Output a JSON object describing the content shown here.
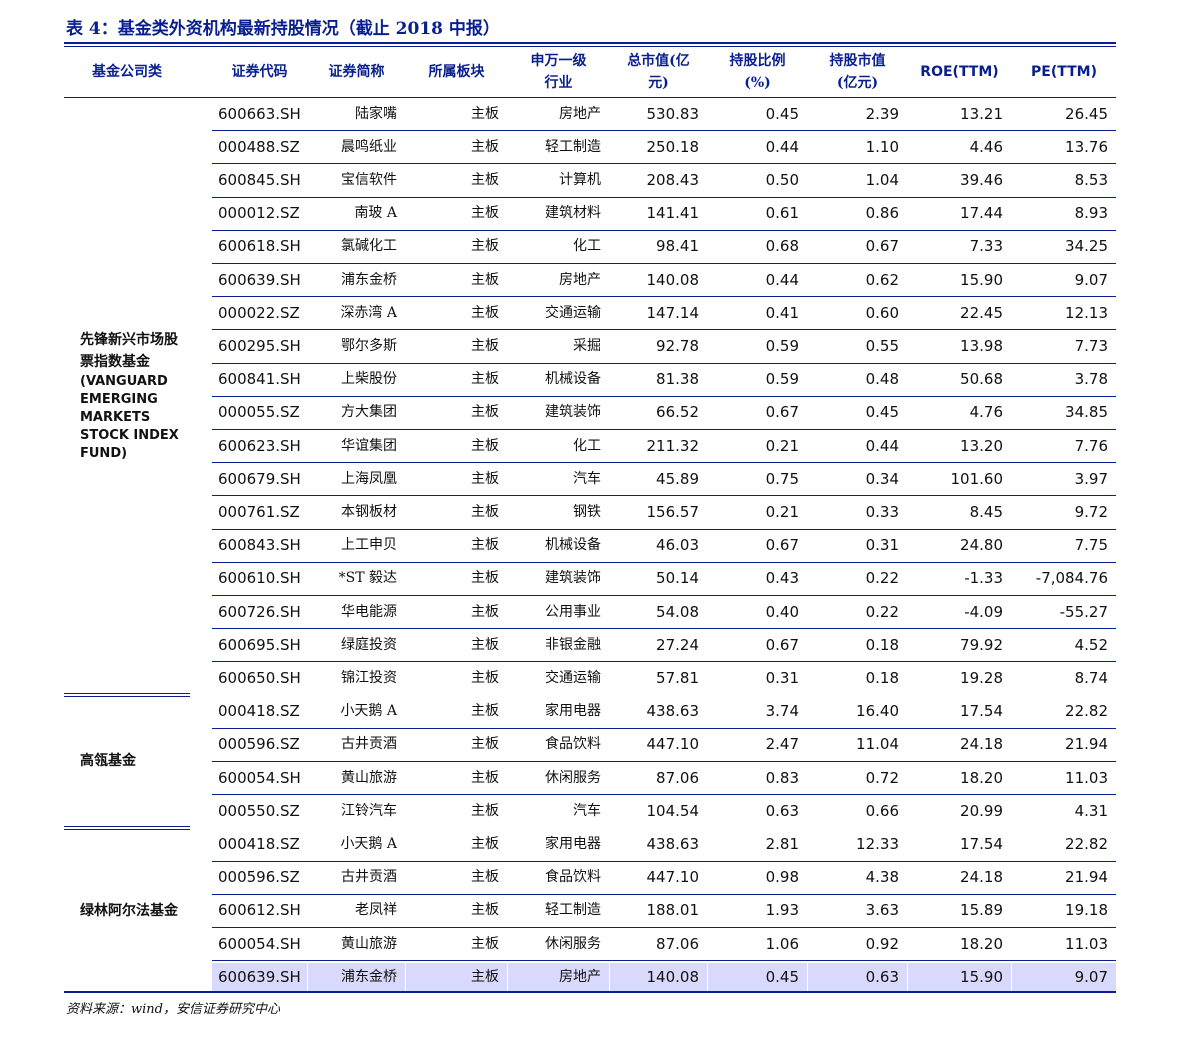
{
  "title": "表 4：基金类外资机构最新持股情况（截止 2018 中报）",
  "headers": {
    "fund": "基金公司类",
    "code": "证券代码",
    "name": "证券简称",
    "board": "所属板块",
    "industry_l1": "申万一级",
    "industry_l2": "行业",
    "mktcap_l1": "总市值(亿",
    "mktcap_l2": "元)",
    "ratio_l1": "持股比例",
    "ratio_l2": "(%)",
    "value_l1": "持股市值",
    "value_l2": "(亿元)",
    "roe": "ROE(TTM)",
    "pe": "PE(TTM)"
  },
  "groups": [
    {
      "label_cn": "先锋新兴市场股票指数基金",
      "label_en": "(VANGUARD EMERGING MARKETS STOCK INDEX FUND)",
      "rows": [
        {
          "code": "600663.SH",
          "name": "陆家嘴",
          "board": "主板",
          "industry": "房地产",
          "mktcap": "530.83",
          "ratio": "0.45",
          "value": "2.39",
          "roe": "13.21",
          "pe": "26.45"
        },
        {
          "code": "000488.SZ",
          "name": "晨鸣纸业",
          "board": "主板",
          "industry": "轻工制造",
          "mktcap": "250.18",
          "ratio": "0.44",
          "value": "1.10",
          "roe": "4.46",
          "pe": "13.76"
        },
        {
          "code": "600845.SH",
          "name": "宝信软件",
          "board": "主板",
          "industry": "计算机",
          "mktcap": "208.43",
          "ratio": "0.50",
          "value": "1.04",
          "roe": "39.46",
          "pe": "8.53"
        },
        {
          "code": "000012.SZ",
          "name": "南玻 A",
          "board": "主板",
          "industry": "建筑材料",
          "mktcap": "141.41",
          "ratio": "0.61",
          "value": "0.86",
          "roe": "17.44",
          "pe": "8.93"
        },
        {
          "code": "600618.SH",
          "name": "氯碱化工",
          "board": "主板",
          "industry": "化工",
          "mktcap": "98.41",
          "ratio": "0.68",
          "value": "0.67",
          "roe": "7.33",
          "pe": "34.25"
        },
        {
          "code": "600639.SH",
          "name": "浦东金桥",
          "board": "主板",
          "industry": "房地产",
          "mktcap": "140.08",
          "ratio": "0.44",
          "value": "0.62",
          "roe": "15.90",
          "pe": "9.07"
        },
        {
          "code": "000022.SZ",
          "name": "深赤湾 A",
          "board": "主板",
          "industry": "交通运输",
          "mktcap": "147.14",
          "ratio": "0.41",
          "value": "0.60",
          "roe": "22.45",
          "pe": "12.13"
        },
        {
          "code": "600295.SH",
          "name": "鄂尔多斯",
          "board": "主板",
          "industry": "采掘",
          "mktcap": "92.78",
          "ratio": "0.59",
          "value": "0.55",
          "roe": "13.98",
          "pe": "7.73"
        },
        {
          "code": "600841.SH",
          "name": "上柴股份",
          "board": "主板",
          "industry": "机械设备",
          "mktcap": "81.38",
          "ratio": "0.59",
          "value": "0.48",
          "roe": "50.68",
          "pe": "3.78"
        },
        {
          "code": "000055.SZ",
          "name": "方大集团",
          "board": "主板",
          "industry": "建筑装饰",
          "mktcap": "66.52",
          "ratio": "0.67",
          "value": "0.45",
          "roe": "4.76",
          "pe": "34.85"
        },
        {
          "code": "600623.SH",
          "name": "华谊集团",
          "board": "主板",
          "industry": "化工",
          "mktcap": "211.32",
          "ratio": "0.21",
          "value": "0.44",
          "roe": "13.20",
          "pe": "7.76"
        },
        {
          "code": "600679.SH",
          "name": "上海凤凰",
          "board": "主板",
          "industry": "汽车",
          "mktcap": "45.89",
          "ratio": "0.75",
          "value": "0.34",
          "roe": "101.60",
          "pe": "3.97"
        },
        {
          "code": "000761.SZ",
          "name": "本钢板材",
          "board": "主板",
          "industry": "钢铁",
          "mktcap": "156.57",
          "ratio": "0.21",
          "value": "0.33",
          "roe": "8.45",
          "pe": "9.72"
        },
        {
          "code": "600843.SH",
          "name": "上工申贝",
          "board": "主板",
          "industry": "机械设备",
          "mktcap": "46.03",
          "ratio": "0.67",
          "value": "0.31",
          "roe": "24.80",
          "pe": "7.75"
        },
        {
          "code": "600610.SH",
          "name": "*ST 毅达",
          "board": "主板",
          "industry": "建筑装饰",
          "mktcap": "50.14",
          "ratio": "0.43",
          "value": "0.22",
          "roe": "-1.33",
          "pe": "-7,084.76"
        },
        {
          "code": "600726.SH",
          "name": "华电能源",
          "board": "主板",
          "industry": "公用事业",
          "mktcap": "54.08",
          "ratio": "0.40",
          "value": "0.22",
          "roe": "-4.09",
          "pe": "-55.27"
        },
        {
          "code": "600695.SH",
          "name": "绿庭投资",
          "board": "主板",
          "industry": "非银金融",
          "mktcap": "27.24",
          "ratio": "0.67",
          "value": "0.18",
          "roe": "79.92",
          "pe": "4.52"
        },
        {
          "code": "600650.SH",
          "name": "锦江投资",
          "board": "主板",
          "industry": "交通运输",
          "mktcap": "57.81",
          "ratio": "0.31",
          "value": "0.18",
          "roe": "19.28",
          "pe": "8.74"
        }
      ]
    },
    {
      "label_cn": "高瓴基金",
      "label_en": "",
      "rows": [
        {
          "code": "000418.SZ",
          "name": "小天鹅 A",
          "board": "主板",
          "industry": "家用电器",
          "mktcap": "438.63",
          "ratio": "3.74",
          "value": "16.40",
          "roe": "17.54",
          "pe": "22.82"
        },
        {
          "code": "000596.SZ",
          "name": "古井贡酒",
          "board": "主板",
          "industry": "食品饮料",
          "mktcap": "447.10",
          "ratio": "2.47",
          "value": "11.04",
          "roe": "24.18",
          "pe": "21.94"
        },
        {
          "code": "600054.SH",
          "name": "黄山旅游",
          "board": "主板",
          "industry": "休闲服务",
          "mktcap": "87.06",
          "ratio": "0.83",
          "value": "0.72",
          "roe": "18.20",
          "pe": "11.03"
        },
        {
          "code": "000550.SZ",
          "name": "江铃汽车",
          "board": "主板",
          "industry": "汽车",
          "mktcap": "104.54",
          "ratio": "0.63",
          "value": "0.66",
          "roe": "20.99",
          "pe": "4.31"
        }
      ]
    },
    {
      "label_cn": "绿林阿尔法基金",
      "label_en": "",
      "rows": [
        {
          "code": "000418.SZ",
          "name": "小天鹅 A",
          "board": "主板",
          "industry": "家用电器",
          "mktcap": "438.63",
          "ratio": "2.81",
          "value": "12.33",
          "roe": "17.54",
          "pe": "22.82"
        },
        {
          "code": "000596.SZ",
          "name": "古井贡酒",
          "board": "主板",
          "industry": "食品饮料",
          "mktcap": "447.10",
          "ratio": "0.98",
          "value": "4.38",
          "roe": "24.18",
          "pe": "21.94"
        },
        {
          "code": "600612.SH",
          "name": "老凤祥",
          "board": "主板",
          "industry": "轻工制造",
          "mktcap": "188.01",
          "ratio": "1.93",
          "value": "3.63",
          "roe": "15.89",
          "pe": "19.18"
        },
        {
          "code": "600054.SH",
          "name": "黄山旅游",
          "board": "主板",
          "industry": "休闲服务",
          "mktcap": "87.06",
          "ratio": "1.06",
          "value": "0.92",
          "roe": "18.20",
          "pe": "11.03"
        },
        {
          "code": "600639.SH",
          "name": "浦东金桥",
          "board": "主板",
          "industry": "房地产",
          "mktcap": "140.08",
          "ratio": "0.45",
          "value": "0.63",
          "roe": "15.90",
          "pe": "9.07",
          "highlight": true
        }
      ]
    }
  ],
  "source": "资料来源：wind，安信证券研究中心"
}
